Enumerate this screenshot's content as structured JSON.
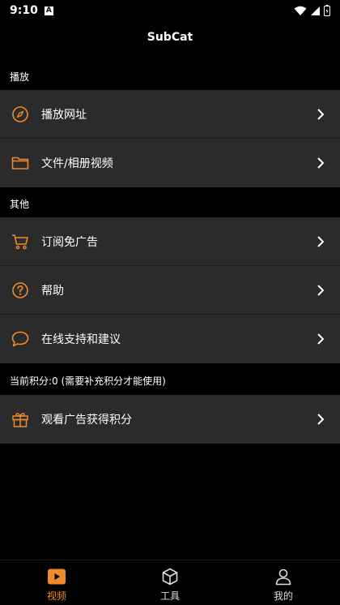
{
  "status_bar": {
    "time": "9:10",
    "notif_letter": "A"
  },
  "header": {
    "title": "SubCat"
  },
  "sections": {
    "play": {
      "label": "播放",
      "items": [
        {
          "label": "播放网址",
          "icon": "compass-icon"
        },
        {
          "label": "文件/相册视频",
          "icon": "folder-icon"
        }
      ]
    },
    "other": {
      "label": "其他",
      "items": [
        {
          "label": "订阅免广告",
          "icon": "cart-icon"
        },
        {
          "label": "帮助",
          "icon": "help-icon"
        },
        {
          "label": "在线支持和建议",
          "icon": "chat-bubble-icon"
        }
      ]
    },
    "points": {
      "label": "当前积分:0 (需要补充积分才能使用)",
      "items": [
        {
          "label": "观看广告获得积分",
          "icon": "gift-icon"
        }
      ]
    }
  },
  "bottom_nav": {
    "items": [
      {
        "label": "视频",
        "icon": "video-play-icon",
        "active": true
      },
      {
        "label": "工具",
        "icon": "cube-icon",
        "active": false
      },
      {
        "label": "我的",
        "icon": "person-icon",
        "active": false
      }
    ]
  },
  "colors": {
    "accent": "#ef8a2a",
    "row_bg": "#2b2b2b",
    "background": "#000000"
  }
}
